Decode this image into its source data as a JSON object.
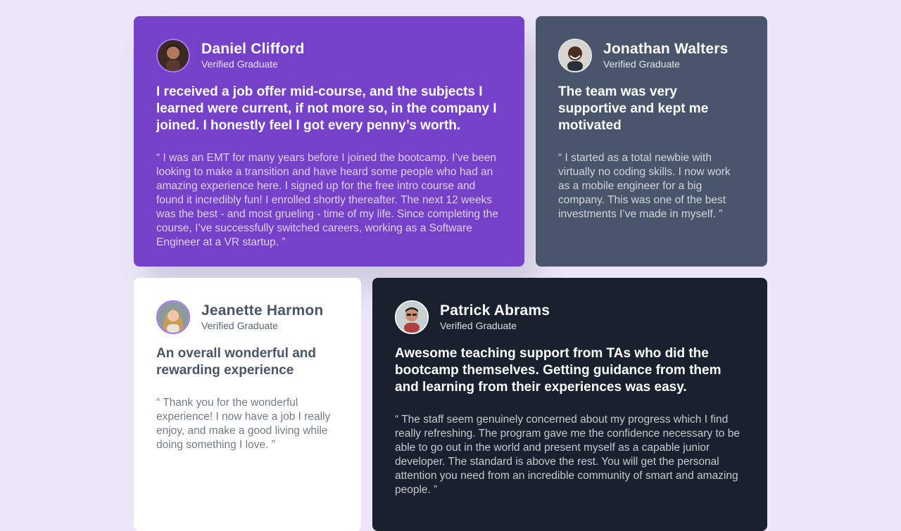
{
  "testimonials": [
    {
      "name": "Daniel Clifford",
      "role": "Verified Graduate",
      "headline": "I received a job offer mid-course, and the subjects I learned were current, if not more so, in the company I joined. I honestly feel I got every penny’s worth.",
      "quote": "“ I was an EMT for many years before I joined the bootcamp. I’ve been looking to make a transition and have heard some people who had an amazing experience here. I signed up for the free intro course and found it incredibly fun! I enrolled shortly thereafter. The next 12 weeks was the best - and most grueling - time of my life. Since completing the course, I’ve successfully switched careers, working as a Software Engineer at a VR startup. ”",
      "background": "#7541C8"
    },
    {
      "name": "Jonathan Walters",
      "role": "Verified Graduate",
      "headline": "The team was very supportive and kept me motivated",
      "quote": "“ I started as a total newbie with virtually no coding skills. I now work as a mobile engineer for a big company. This was one of the best investments I’ve made in myself. ”",
      "background": "#48556A"
    },
    {
      "name": "Jeanette Harmon",
      "role": "Verified Graduate",
      "headline": "An overall wonderful and rewarding experience",
      "quote": "“ Thank you for the wonderful experience! I now have a job I really enjoy, and make a good living while doing something I love. ”",
      "background": "#FFFFFF"
    },
    {
      "name": "Patrick Abrams",
      "role": "Verified Graduate",
      "headline": "Awesome teaching support from TAs who did the bootcamp themselves. Getting guidance from them and learning from their experiences was easy.",
      "quote": "“ The staff seem genuinely concerned about my progress which I find really refreshing. The program gave me the confidence necessary to be able to go out in the world and present myself as a capable junior developer. The standard is above the rest. You will get the personal attention you need from an incredible community of smart and amazing people. ”",
      "background": "#19212E"
    }
  ],
  "colors": {
    "page_background": "#ECE6F8",
    "accent": "#A775F1",
    "text_dark": "#48556A"
  }
}
